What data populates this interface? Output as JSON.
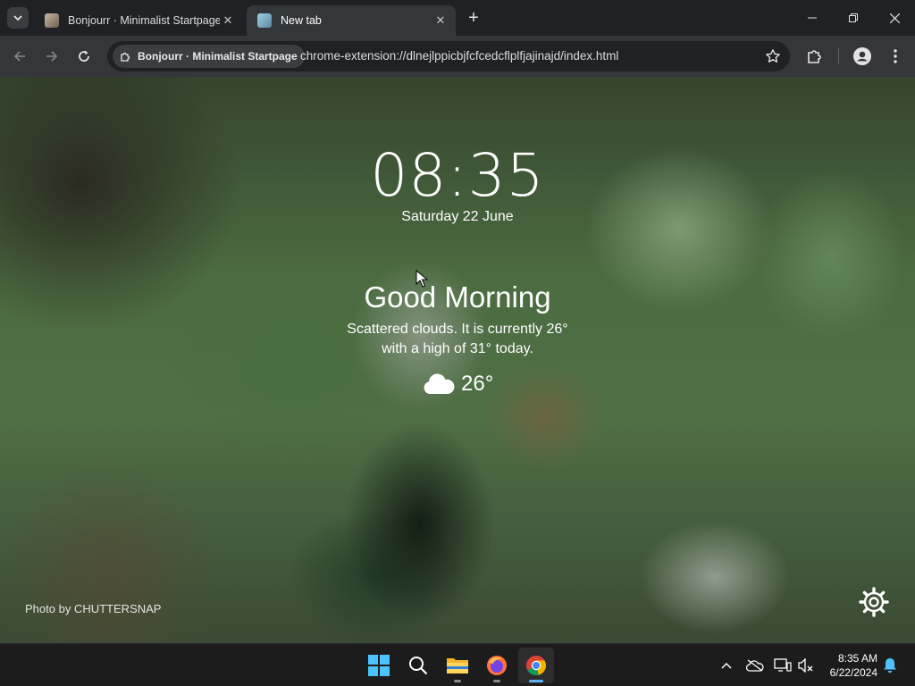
{
  "browser": {
    "tabs": [
      {
        "title": "Bonjourr · Minimalist Startpage",
        "active": false
      },
      {
        "title": "New tab",
        "active": true
      }
    ],
    "omnibox": {
      "chip_label": "Bonjourr · Minimalist Startpage",
      "url": "chrome-extension://dlnejlppicbjfcfcedcflplfjajinajd/index.html"
    }
  },
  "startpage": {
    "time": "08:35",
    "date": "Saturday 22 June",
    "greeting": "Good Morning",
    "weather_line1": "Scattered clouds. It is currently 26°",
    "weather_line2": "with a high of 31° today.",
    "temperature": "26°",
    "weather_icon": "cloud-icon",
    "photo_credit": "Photo by CHUTTERSNAP"
  },
  "taskbar": {
    "apps": [
      "windows-start",
      "search",
      "file-explorer",
      "firefox",
      "chrome"
    ],
    "time": "8:35 AM",
    "date": "6/22/2024"
  }
}
